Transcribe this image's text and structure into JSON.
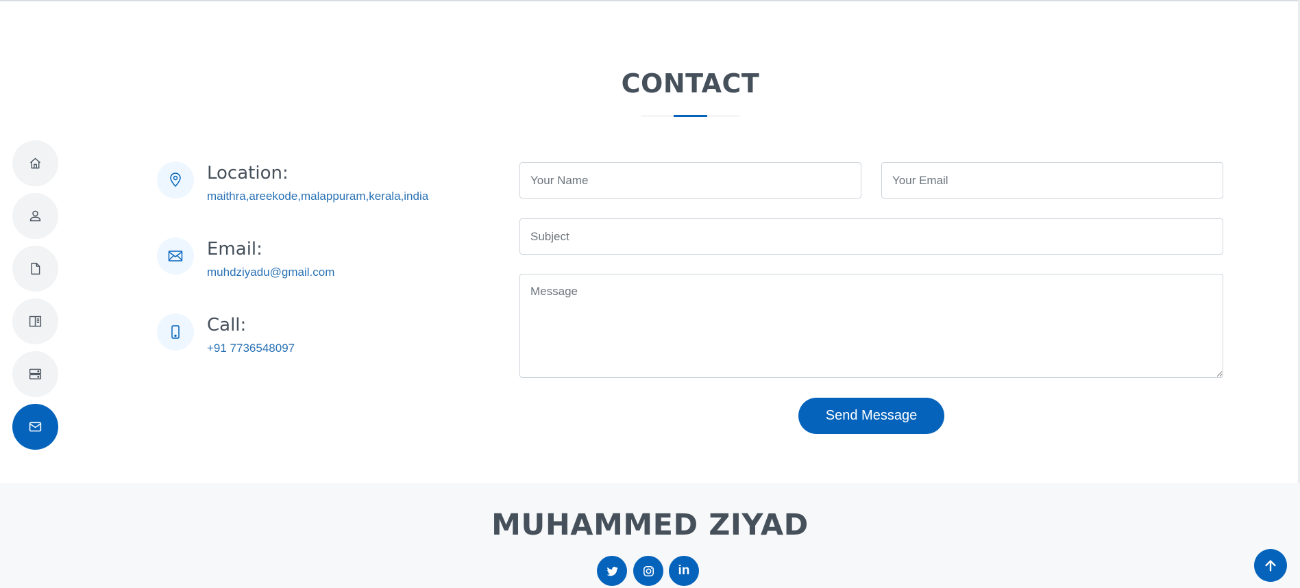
{
  "contact": {
    "title": "CONTACT",
    "info": [
      {
        "icon": "map-pin-icon",
        "title": "Location:",
        "value": "maithra,areekode,malappuram,kerala,india"
      },
      {
        "icon": "envelope-icon",
        "title": "Email:",
        "value": "muhdziyadu@gmail.com"
      },
      {
        "icon": "phone-icon",
        "title": "Call:",
        "value": "+91 7736548097"
      }
    ],
    "form": {
      "name_placeholder": "Your Name",
      "email_placeholder": "Your Email",
      "subject_placeholder": "Subject",
      "message_placeholder": "Message",
      "submit_label": "Send Message"
    }
  },
  "nav": [
    {
      "icon": "home-icon",
      "active": false
    },
    {
      "icon": "person-icon",
      "active": false
    },
    {
      "icon": "file-icon",
      "active": false
    },
    {
      "icon": "book-icon",
      "active": false
    },
    {
      "icon": "server-icon",
      "active": false
    },
    {
      "icon": "envelope-icon",
      "active": true
    }
  ],
  "footer": {
    "name": "MUHAMMED ZIYAD",
    "social": [
      {
        "icon": "twitter-icon"
      },
      {
        "icon": "instagram-icon"
      },
      {
        "icon": "linkedin-icon",
        "label": "in"
      }
    ]
  },
  "back_to_top_icon": "arrow-up-icon",
  "colors": {
    "accent": "#0563bb",
    "text": "#45505b",
    "link": "#2a72b5",
    "nav_bg": "#f2f3f5",
    "icon_bg": "#eef7ff",
    "footer_bg": "#f7f8f9"
  }
}
